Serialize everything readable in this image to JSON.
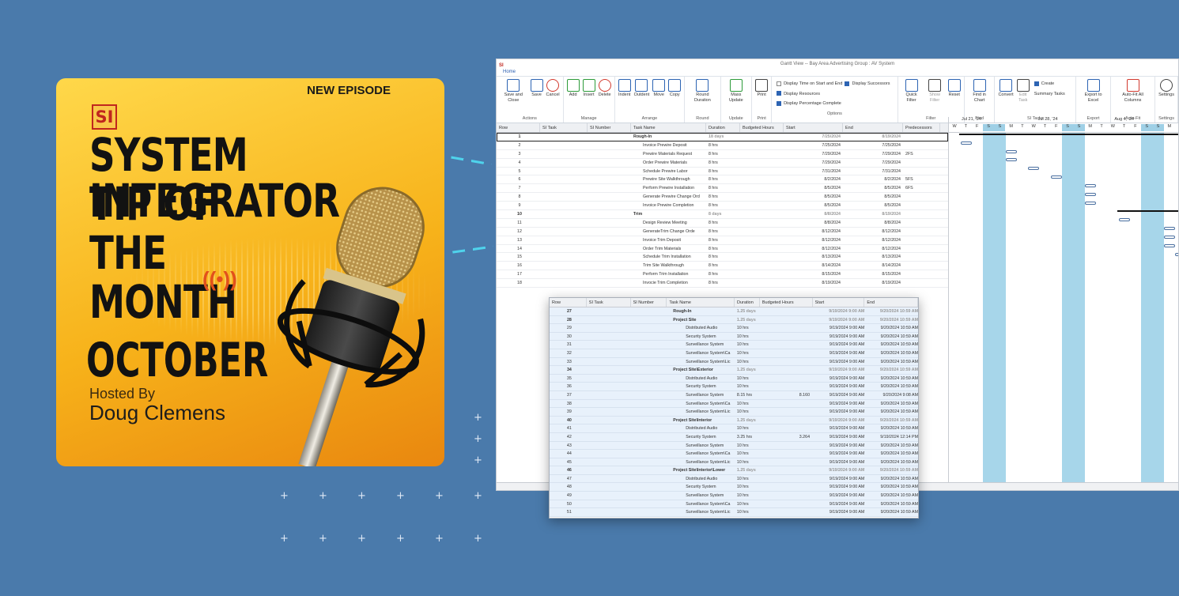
{
  "podcast": {
    "badge": "NEW EPISODE",
    "logo": "SI",
    "title_lines": [
      "SYSTEM INTEGRATOR",
      "TIP OF",
      "THE",
      "MONTH"
    ],
    "month": "OCTOBER",
    "hosted_by": "Hosted By",
    "host": "Doug Clemens"
  },
  "window": {
    "app_icon": "SI",
    "title": "Gantt View -- Bay Area Advertising Group : AV System",
    "tab": "Home",
    "ribbon": {
      "groups": [
        {
          "name": "Actions",
          "buttons": [
            "Save and Close",
            "Save",
            "Cancel"
          ]
        },
        {
          "name": "Manage",
          "buttons": [
            "Add",
            "Insert",
            "Delete"
          ]
        },
        {
          "name": "Arrange",
          "buttons": [
            "Indent",
            "Outdent",
            "Move",
            "Copy"
          ]
        },
        {
          "name": "Round",
          "buttons": [
            "Round Duration"
          ]
        },
        {
          "name": "Update",
          "buttons": [
            "Mass Update"
          ]
        },
        {
          "name": "Print",
          "buttons": [
            "Print"
          ]
        },
        {
          "name": "Filter",
          "buttons": [
            "Quick Filter",
            "Show Filter",
            "Reset"
          ]
        },
        {
          "name": "Find",
          "buttons": [
            "Find in Chart"
          ]
        },
        {
          "name": "SI Tasks",
          "buttons": [
            "Convert",
            "Edit Task"
          ]
        },
        {
          "name": "Export",
          "buttons": [
            "Export to Excel"
          ]
        },
        {
          "name": "Auto-Fit",
          "buttons": [
            "Auto-Fit All Columns"
          ]
        },
        {
          "name": "Settings",
          "buttons": [
            "Settings"
          ]
        }
      ],
      "options": {
        "group_name": "Options",
        "display_time": "Display Time on Start and End",
        "display_successors": "Display Successors",
        "display_resources": "Display Resources",
        "display_pct": "Display Percentage Complete",
        "create_summary": "Create Summary Tasks"
      }
    },
    "columns": [
      "Row",
      "SI Task",
      "SI Number",
      "Task Name",
      "Duration",
      "Budgeted Hours",
      "Start",
      "End",
      "Predecessors"
    ],
    "rows": [
      {
        "row": "1",
        "name": "Rough-In",
        "dur": "18 days",
        "bh": "",
        "start": "7/25/2024",
        "end": "8/19/2024",
        "pred": "",
        "summary": true
      },
      {
        "row": "2",
        "name": "Invoice Prewire Deposit",
        "dur": "8 hrs",
        "bh": "",
        "start": "7/25/2024",
        "end": "7/25/2024",
        "pred": ""
      },
      {
        "row": "3",
        "name": "Prewire Materials Request",
        "dur": "8 hrs",
        "bh": "",
        "start": "7/29/2024",
        "end": "7/29/2024",
        "pred": "2FS"
      },
      {
        "row": "4",
        "name": "Order Prewire Materials",
        "dur": "8 hrs",
        "bh": "",
        "start": "7/29/2024",
        "end": "7/29/2024",
        "pred": ""
      },
      {
        "row": "5",
        "name": "Schedule Prewire Labor",
        "dur": "8 hrs",
        "bh": "",
        "start": "7/31/2024",
        "end": "7/31/2024",
        "pred": ""
      },
      {
        "row": "6",
        "name": "Prewire Site Walkthrough",
        "dur": "8 hrs",
        "bh": "",
        "start": "8/2/2024",
        "end": "8/2/2024",
        "pred": "5FS"
      },
      {
        "row": "7",
        "name": "Perform Prewire Installation",
        "dur": "8 hrs",
        "bh": "",
        "start": "8/5/2024",
        "end": "8/5/2024",
        "pred": "6FS"
      },
      {
        "row": "8",
        "name": "Generate Prewire Change Ord",
        "dur": "8 hrs",
        "bh": "",
        "start": "8/5/2024",
        "end": "8/5/2024",
        "pred": ""
      },
      {
        "row": "9",
        "name": "Invoice Prewire Completion",
        "dur": "8 hrs",
        "bh": "",
        "start": "8/5/2024",
        "end": "8/5/2024",
        "pred": ""
      },
      {
        "row": "10",
        "name": "Trim",
        "dur": "8 days",
        "bh": "",
        "start": "8/8/2024",
        "end": "8/19/2024",
        "pred": "",
        "summary": true
      },
      {
        "row": "11",
        "name": "Design Review Meeting",
        "dur": "8 hrs",
        "bh": "",
        "start": "8/8/2024",
        "end": "8/8/2024",
        "pred": ""
      },
      {
        "row": "12",
        "name": "GenerateTrim Change Orde",
        "dur": "8 hrs",
        "bh": "",
        "start": "8/12/2024",
        "end": "8/12/2024",
        "pred": ""
      },
      {
        "row": "13",
        "name": "Invoice Trim Deposit",
        "dur": "8 hrs",
        "bh": "",
        "start": "8/12/2024",
        "end": "8/12/2024",
        "pred": ""
      },
      {
        "row": "14",
        "name": "Order Trim Materials",
        "dur": "8 hrs",
        "bh": "",
        "start": "8/12/2024",
        "end": "8/12/2024",
        "pred": ""
      },
      {
        "row": "15",
        "name": "Schedule Trim Installation",
        "dur": "8 hrs",
        "bh": "",
        "start": "8/13/2024",
        "end": "8/13/2024",
        "pred": ""
      },
      {
        "row": "16",
        "name": "Trim Site Walkthrough",
        "dur": "8 hrs",
        "bh": "",
        "start": "8/14/2024",
        "end": "8/14/2024",
        "pred": ""
      },
      {
        "row": "17",
        "name": "Perform Trim Installation",
        "dur": "8 hrs",
        "bh": "",
        "start": "8/15/2024",
        "end": "8/15/2024",
        "pred": ""
      },
      {
        "row": "18",
        "name": "Invocie Trim Completion",
        "dur": "8 hrs",
        "bh": "",
        "start": "8/19/2024",
        "end": "8/19/2024",
        "pred": ""
      }
    ],
    "gantt": {
      "weeks": [
        "Jul 21, '24",
        "Jul 28, '24",
        "Aug 4, '24"
      ],
      "days": [
        "W",
        "T",
        "F",
        "S",
        "S",
        "M",
        "T",
        "W",
        "T",
        "F",
        "S",
        "S",
        "M",
        "T",
        "W",
        "T",
        "F",
        "S",
        "S",
        "M"
      ]
    }
  },
  "popup": {
    "columns": [
      "Row",
      "SI Task",
      "SI Number",
      "Task Name",
      "Duration",
      "Budgeted Hours",
      "Start",
      "End"
    ],
    "rows": [
      {
        "row": "27",
        "name": "Rough-In",
        "dur": "1.25 days",
        "bh": "",
        "start": "9/19/2024 9:00 AM",
        "end": "9/20/2024 10:59 AM",
        "lvl": 0,
        "summary": true
      },
      {
        "row": "28",
        "name": "Project Site",
        "dur": "1.25 days",
        "bh": "",
        "start": "9/19/2024 9:00 AM",
        "end": "9/20/2024 10:59 AM",
        "lvl": 1,
        "summary": true
      },
      {
        "row": "29",
        "name": "Distributed Audio",
        "dur": "10 hrs",
        "bh": "",
        "start": "9/19/2024 9:00 AM",
        "end": "9/20/2024 10:59 AM",
        "lvl": 2
      },
      {
        "row": "30",
        "name": "Security System",
        "dur": "10 hrs",
        "bh": "",
        "start": "9/19/2024 9:00 AM",
        "end": "9/20/2024 10:59 AM",
        "lvl": 2
      },
      {
        "row": "31",
        "name": "Surveillance System",
        "dur": "10 hrs",
        "bh": "",
        "start": "9/19/2024 9:00 AM",
        "end": "9/20/2024 10:59 AM",
        "lvl": 2
      },
      {
        "row": "32",
        "name": "Surveillance System\\Ca",
        "dur": "10 hrs",
        "bh": "",
        "start": "9/19/2024 9:00 AM",
        "end": "9/20/2024 10:59 AM",
        "lvl": 2
      },
      {
        "row": "33",
        "name": "Surveillance System\\Lic",
        "dur": "10 hrs",
        "bh": "",
        "start": "9/19/2024 9:00 AM",
        "end": "9/20/2024 10:59 AM",
        "lvl": 2
      },
      {
        "row": "34",
        "name": "Project Site\\Exterior",
        "dur": "1.25 days",
        "bh": "",
        "start": "9/19/2024 9:00 AM",
        "end": "9/20/2024 10:59 AM",
        "lvl": 1,
        "summary": true
      },
      {
        "row": "35",
        "name": "Distributed Audio",
        "dur": "10 hrs",
        "bh": "",
        "start": "9/19/2024 9:00 AM",
        "end": "9/20/2024 10:59 AM",
        "lvl": 2
      },
      {
        "row": "36",
        "name": "Security System",
        "dur": "10 hrs",
        "bh": "",
        "start": "9/19/2024 9:00 AM",
        "end": "9/20/2024 10:59 AM",
        "lvl": 2
      },
      {
        "row": "37",
        "name": "Surveillance System",
        "dur": "8.15 hrs",
        "bh": "8.160",
        "start": "9/19/2024 9:00 AM",
        "end": "9/20/2024 9:08 AM",
        "lvl": 2
      },
      {
        "row": "38",
        "name": "Surveillance System\\Ca",
        "dur": "10 hrs",
        "bh": "",
        "start": "9/19/2024 9:00 AM",
        "end": "9/20/2024 10:59 AM",
        "lvl": 2
      },
      {
        "row": "39",
        "name": "Surveillance System\\Lic",
        "dur": "10 hrs",
        "bh": "",
        "start": "9/19/2024 9:00 AM",
        "end": "9/20/2024 10:59 AM",
        "lvl": 2
      },
      {
        "row": "40",
        "name": "Project Site\\Interior",
        "dur": "1.25 days",
        "bh": "",
        "start": "9/19/2024 9:00 AM",
        "end": "9/20/2024 10:59 AM",
        "lvl": 1,
        "summary": true
      },
      {
        "row": "41",
        "name": "Distributed Audio",
        "dur": "10 hrs",
        "bh": "",
        "start": "9/19/2024 9:00 AM",
        "end": "9/20/2024 10:59 AM",
        "lvl": 2
      },
      {
        "row": "42",
        "name": "Security System",
        "dur": "3.25 hrs",
        "bh": "3.264",
        "start": "9/19/2024 9:00 AM",
        "end": "9/19/2024 12:14 PM",
        "lvl": 2
      },
      {
        "row": "43",
        "name": "Surveillance System",
        "dur": "10 hrs",
        "bh": "",
        "start": "9/19/2024 9:00 AM",
        "end": "9/20/2024 10:59 AM",
        "lvl": 2
      },
      {
        "row": "44",
        "name": "Surveillance System\\Ca",
        "dur": "10 hrs",
        "bh": "",
        "start": "9/19/2024 9:00 AM",
        "end": "9/20/2024 10:59 AM",
        "lvl": 2
      },
      {
        "row": "45",
        "name": "Surveillance System\\Lic",
        "dur": "10 hrs",
        "bh": "",
        "start": "9/19/2024 9:00 AM",
        "end": "9/20/2024 10:59 AM",
        "lvl": 2
      },
      {
        "row": "46",
        "name": "Project Site\\Interior\\Lower",
        "dur": "1.25 days",
        "bh": "",
        "start": "9/19/2024 9:00 AM",
        "end": "9/20/2024 10:59 AM",
        "lvl": 1,
        "summary": true
      },
      {
        "row": "47",
        "name": "Distributed Audio",
        "dur": "10 hrs",
        "bh": "",
        "start": "9/19/2024 9:00 AM",
        "end": "9/20/2024 10:59 AM",
        "lvl": 2
      },
      {
        "row": "48",
        "name": "Security System",
        "dur": "10 hrs",
        "bh": "",
        "start": "9/19/2024 9:00 AM",
        "end": "9/20/2024 10:59 AM",
        "lvl": 2
      },
      {
        "row": "49",
        "name": "Surveillance System",
        "dur": "10 hrs",
        "bh": "",
        "start": "9/19/2024 9:00 AM",
        "end": "9/20/2024 10:59 AM",
        "lvl": 2
      },
      {
        "row": "50",
        "name": "Surveillance System\\Ca",
        "dur": "10 hrs",
        "bh": "",
        "start": "9/19/2024 9:00 AM",
        "end": "9/20/2024 10:59 AM",
        "lvl": 2
      },
      {
        "row": "51",
        "name": "Surveillance System\\Lic",
        "dur": "10 hrs",
        "bh": "",
        "start": "9/19/2024 9:00 AM",
        "end": "9/20/2024 10:59 AM",
        "lvl": 2
      }
    ]
  }
}
